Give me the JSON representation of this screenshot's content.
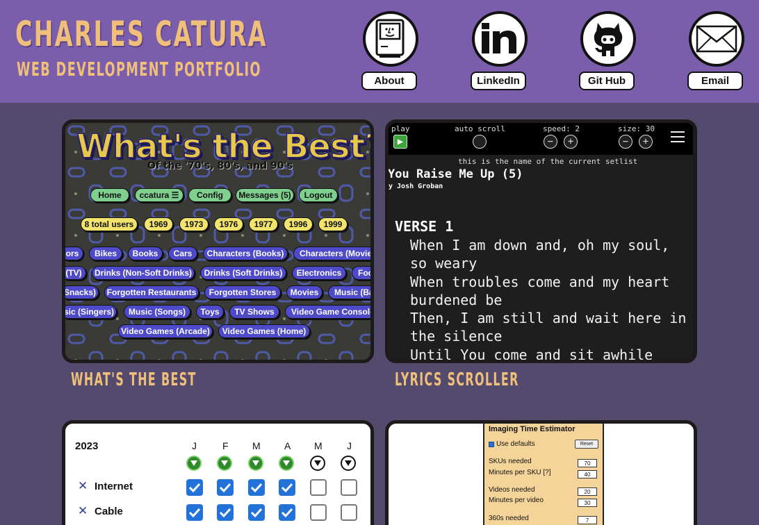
{
  "header": {
    "name": "CHARLES CATURA",
    "subtitle": "WEB DEVELOPMENT PORTFOLIO",
    "nav": [
      {
        "label": "About",
        "icon": "computer-icon"
      },
      {
        "label": "LinkedIn",
        "icon": "linkedin-icon"
      },
      {
        "label": "Git Hub",
        "icon": "github-icon"
      },
      {
        "label": "Email",
        "icon": "envelope-icon"
      }
    ]
  },
  "projects": {
    "whats_the_best": {
      "caption": "WHAT'S THE BEST",
      "logo": "What's the Best?",
      "tagline": "Of the '70's, 80's, and 90's",
      "nav": [
        "Home",
        "ccatura ☰",
        "Config",
        "Messages (5)",
        "Logout"
      ],
      "years": [
        "8 total users",
        "1969",
        "1973",
        "1976",
        "1977",
        "1996",
        "1999"
      ],
      "categories": [
        [
          "ors",
          "Bikes",
          "Books",
          "Cars",
          "Characters (Books)",
          "Characters (Movies"
        ],
        [
          "(TV)",
          "Drinks (Non-Soft Drinks)",
          "Drinks (Soft Drinks)",
          "Electronics",
          "Foo"
        ],
        [
          "Snacks)",
          "Forgotten Restaurants",
          "Forgotten Stores",
          "Movies",
          "Music (Ba"
        ],
        [
          "sic (Singers)",
          "Music (Songs)",
          "Toys",
          "TV Shows",
          "Video Game Console"
        ],
        [
          "Video Games (Arcade)",
          "Video Games (Home)"
        ]
      ]
    },
    "lyrics_scroller": {
      "caption": "LYRICS SCROLLER",
      "controls": {
        "play": "play",
        "auto_scroll": "auto scroll",
        "speed": "speed: 2",
        "size": "size: 30"
      },
      "setlist": "this is the name of the current setlist",
      "song_title": "You Raise Me Up (5)",
      "artist": "y Josh Groban",
      "section": "VERSE 1",
      "lines": [
        "When I am down and, oh my soul,",
        "so weary",
        "When troubles come and my heart",
        "burdened be",
        "Then, I am still and wait here in",
        "the silence",
        "Until You come and sit awhile"
      ]
    },
    "subscriptions": {
      "year": "2023",
      "months": [
        "J",
        "F",
        "M",
        "A",
        "M",
        "J"
      ],
      "months_filled": [
        true,
        true,
        true,
        true,
        false,
        false
      ],
      "rows": [
        {
          "label": "Internet",
          "checks": [
            true,
            true,
            true,
            true,
            false,
            false
          ]
        },
        {
          "label": "Cable",
          "checks": [
            true,
            true,
            true,
            true,
            false,
            false
          ]
        }
      ]
    },
    "imaging": {
      "title": "Imaging Time Estimator",
      "use_defaults": "Use defaults",
      "reset": "Reset",
      "fields": [
        {
          "label": "SKUs needed",
          "value": "70"
        },
        {
          "label": "Minutes per SKU [?]",
          "value": "40"
        },
        {
          "label": "Videos needed",
          "value": "20"
        },
        {
          "label": "Minutes per video",
          "value": "30"
        },
        {
          "label": "360s needed",
          "value": "7"
        }
      ]
    }
  }
}
